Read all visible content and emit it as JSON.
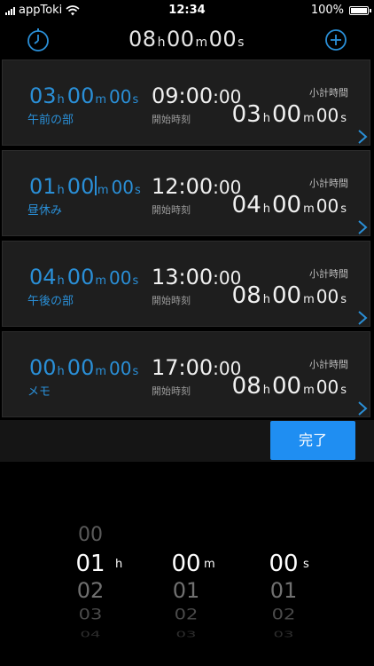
{
  "status_bar": {
    "carrier": "appToki",
    "time": "12:34",
    "battery": "100%",
    "battery_level": 1.0
  },
  "nav": {
    "total": {
      "h": "08",
      "h_unit": "h",
      "m": "00",
      "m_unit": "m",
      "s": "00",
      "s_unit": "s"
    }
  },
  "labels": {
    "start": "開始時刻",
    "subtotal": "小計時間"
  },
  "segments": [
    {
      "dur": {
        "h": "03",
        "m": "00",
        "s": "00"
      },
      "name": "午前の部",
      "start_hm": "09:00",
      "start_s": ":00",
      "subtotal": {
        "h": "03",
        "m": "00",
        "s": "00"
      }
    },
    {
      "dur": {
        "h": "01",
        "m": "00",
        "s": "00"
      },
      "name": "昼休み",
      "start_hm": "12:00",
      "start_s": ":00",
      "subtotal": {
        "h": "04",
        "m": "00",
        "s": "00"
      }
    },
    {
      "dur": {
        "h": "04",
        "m": "00",
        "s": "00"
      },
      "name": "午後の部",
      "start_hm": "13:00",
      "start_s": ":00",
      "subtotal": {
        "h": "08",
        "m": "00",
        "s": "00"
      }
    },
    {
      "dur": {
        "h": "00",
        "m": "00",
        "s": "00"
      },
      "name": "メモ",
      "start_hm": "17:00",
      "start_s": ":00",
      "subtotal": {
        "h": "08",
        "m": "00",
        "s": "00"
      }
    }
  ],
  "units": {
    "h": "h",
    "m": "m",
    "s": "s"
  },
  "done_label": "完了",
  "picker": {
    "hours": {
      "above": "00",
      "selected": "01",
      "below": [
        "02",
        "03",
        "04"
      ]
    },
    "minutes": {
      "above": "",
      "selected": "00",
      "below": [
        "01",
        "02",
        "03"
      ]
    },
    "seconds": {
      "above": "",
      "selected": "00",
      "below": [
        "01",
        "02",
        "03"
      ]
    }
  },
  "colors": {
    "accent": "#2a8fd7",
    "button": "#1f8ef2",
    "card": "#1e1e1e"
  }
}
